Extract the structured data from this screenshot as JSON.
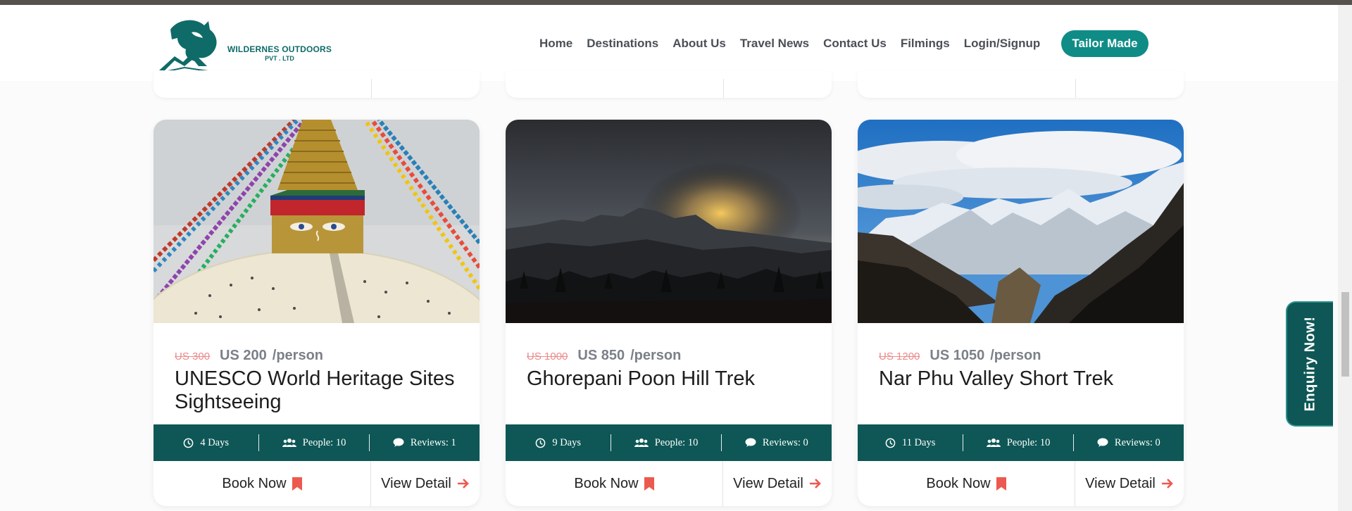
{
  "brand": {
    "line1": "WILDERNES OUTDOORS",
    "line2": "PVT . LTD",
    "color": "#0f6b68"
  },
  "nav": {
    "items": [
      "Home",
      "Destinations",
      "About Us",
      "Travel News",
      "Contact Us",
      "Filmings",
      "Login/Signup"
    ],
    "cta": "Tailor Made"
  },
  "cards": [
    {
      "old_price": "US 300",
      "price": "US 200",
      "per": "/person",
      "title": "UNESCO World Heritage Sites Sightseeing",
      "days": "4 Days",
      "people": "People: 10",
      "reviews": "Reviews: 1",
      "book": "Book Now",
      "view": "View Detail"
    },
    {
      "old_price": "US 1000",
      "price": "US 850",
      "per": "/person",
      "title": "Ghorepani Poon Hill Trek",
      "days": "9 Days",
      "people": "People: 10",
      "reviews": "Reviews: 0",
      "book": "Book Now",
      "view": "View Detail"
    },
    {
      "old_price": "US 1200",
      "price": "US 1050",
      "per": "/person",
      "title": "Nar Phu Valley Short Trek",
      "days": "11 Days",
      "people": "People: 10",
      "reviews": "Reviews: 0",
      "book": "Book Now",
      "view": "View Detail"
    }
  ],
  "enquiry": {
    "label": "Enquiry Now!"
  },
  "icons": {
    "clock": "clock-icon",
    "people": "people-icon",
    "comment": "comment-icon",
    "bookmark": "bookmark-icon",
    "arrow": "arrow-right-icon"
  },
  "colors": {
    "teal_dark": "#0e5756",
    "teal_button": "#0f8c86",
    "accent_red": "#ec5a4f",
    "old_price": "#ec8a8a"
  }
}
